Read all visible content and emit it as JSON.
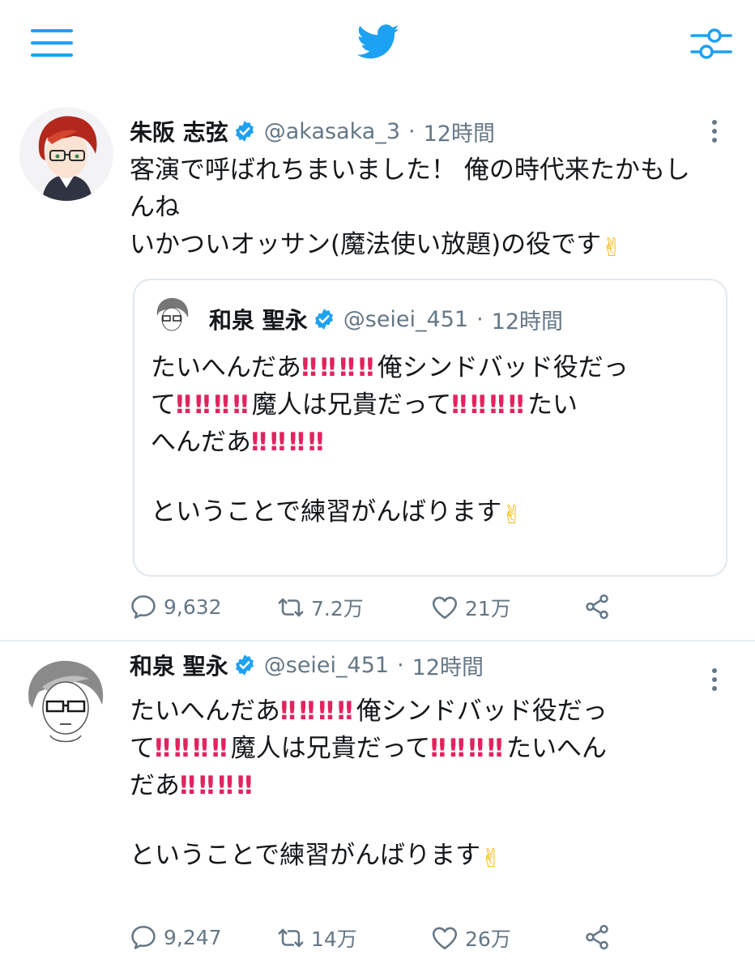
{
  "topbar": {
    "menu_icon": "hamburger-menu-icon",
    "logo_icon": "twitter-bird-icon",
    "settings_icon": "sliders-icon",
    "accent_color": "#1da1f2"
  },
  "tweets": [
    {
      "name": "朱阪 志弦",
      "handle": "@akasaka_3",
      "separator": "·",
      "time": "12時間",
      "verified": true,
      "text_lines": [
        "客演で呼ばれちまいました！ 俺の時代来たかもし",
        "んね",
        "いかついオッサン(魔法使い放題)の役です"
      ],
      "emoji_end": "✌",
      "quote": {
        "name": "和泉 聖永",
        "handle": "@seiei_451",
        "separator": "·",
        "time": "12時間",
        "verified": true,
        "lines": [
          {
            "pre": "たいへんだあ",
            "marks": "‼‼‼‼",
            "post": "俺シンドバッド役だっ"
          },
          {
            "pre": "て",
            "marks": "‼‼‼‼",
            "post": "魔人は兄貴だって",
            "marks2": "‼‼‼‼",
            "post2": "たい"
          },
          {
            "pre": "へんだあ",
            "marks": "‼‼‼‼",
            "post": ""
          }
        ],
        "closing": "ということで練習がんばります",
        "emoji_end": "✌"
      },
      "actions": {
        "replies": "9,632",
        "retweets": "7.2万",
        "likes": "21万"
      }
    },
    {
      "name": "和泉 聖永",
      "handle": "@seiei_451",
      "separator": "·",
      "time": "12時間",
      "verified": true,
      "lines": [
        {
          "pre": "たいへんだあ",
          "marks": "‼‼‼‼",
          "post": "俺シンドバッド役だっ"
        },
        {
          "pre": "て",
          "marks": "‼‼‼‼",
          "post": "魔人は兄貴だって",
          "marks2": "‼‼‼‼",
          "post2": "たいへん"
        },
        {
          "pre": "だあ",
          "marks": "‼‼‼‼",
          "post": ""
        }
      ],
      "closing": "ということで練習がんばります",
      "emoji_end": "✌",
      "actions": {
        "replies": "9,247",
        "retweets": "14万",
        "likes": "26万"
      }
    }
  ],
  "colors": {
    "secondary_text": "#657786",
    "verified_badge": "#1da1f2",
    "exclamation": "#e0245e",
    "border": "#e1e8ed"
  }
}
